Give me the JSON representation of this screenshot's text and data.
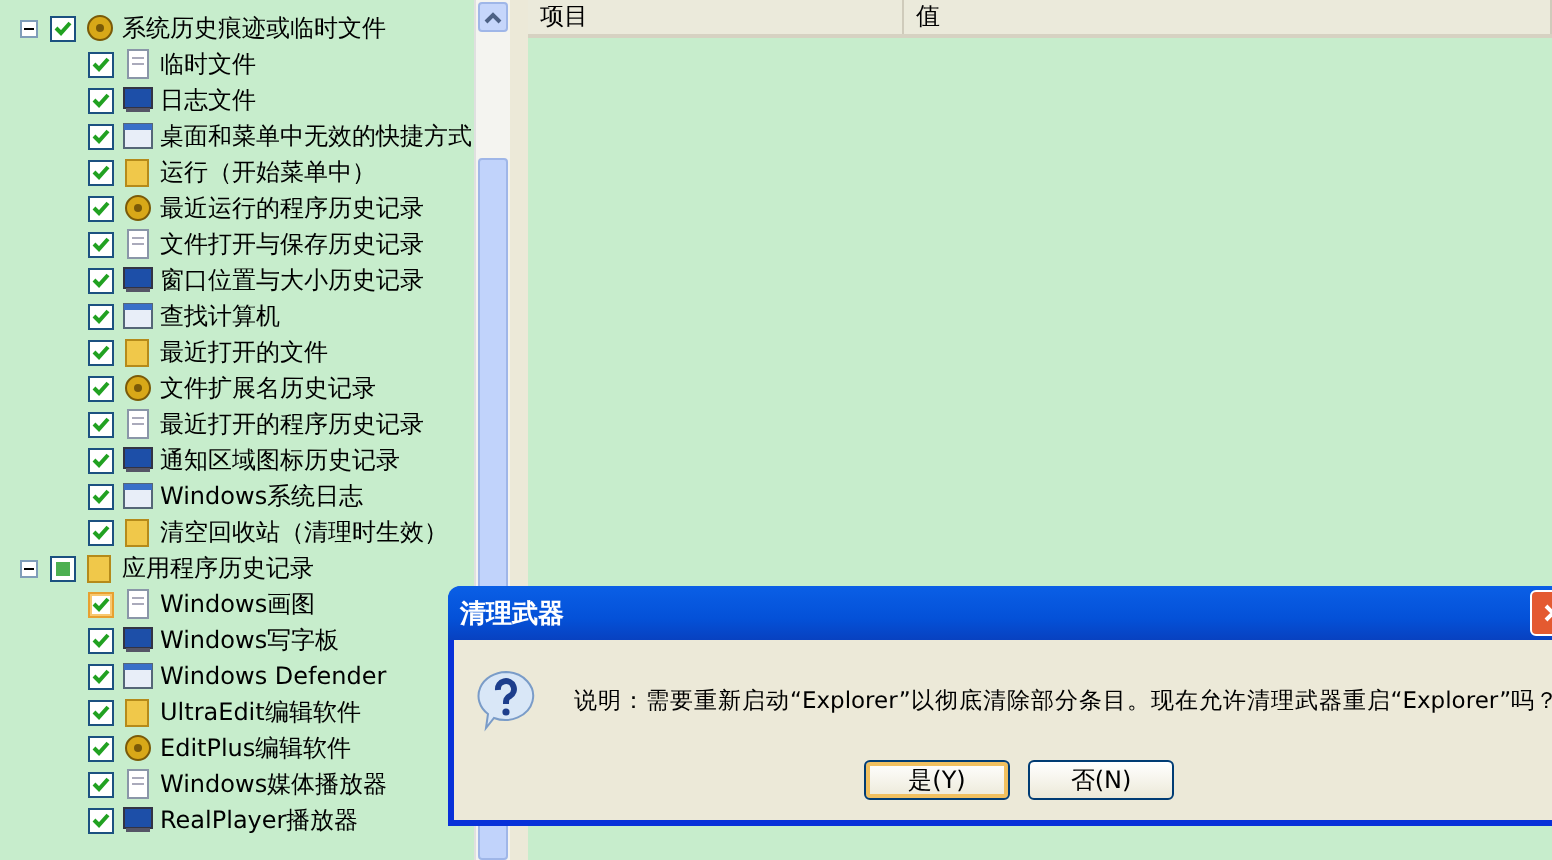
{
  "tree": [
    {
      "label": "系统历史痕迹或临时文件",
      "expanded": true,
      "checked": true,
      "partial": false,
      "children": [
        {
          "label": "临时文件",
          "checked": true,
          "hovered": false
        },
        {
          "label": "日志文件",
          "checked": true,
          "hovered": false
        },
        {
          "label": "桌面和菜单中无效的快捷方式",
          "checked": true,
          "hovered": false
        },
        {
          "label": "运行（开始菜单中）",
          "checked": true,
          "hovered": false
        },
        {
          "label": "最近运行的程序历史记录",
          "checked": true,
          "hovered": false
        },
        {
          "label": "文件打开与保存历史记录",
          "checked": true,
          "hovered": false
        },
        {
          "label": "窗口位置与大小历史记录",
          "checked": true,
          "hovered": false
        },
        {
          "label": "查找计算机",
          "checked": true,
          "hovered": false
        },
        {
          "label": "最近打开的文件",
          "checked": true,
          "hovered": false
        },
        {
          "label": "文件扩展名历史记录",
          "checked": true,
          "hovered": false
        },
        {
          "label": "最近打开的程序历史记录",
          "checked": true,
          "hovered": false
        },
        {
          "label": "通知区域图标历史记录",
          "checked": true,
          "hovered": false
        },
        {
          "label": "Windows系统日志",
          "checked": true,
          "hovered": false
        },
        {
          "label": "清空回收站（清理时生效）",
          "checked": true,
          "hovered": false
        }
      ]
    },
    {
      "label": "应用程序历史记录",
      "expanded": true,
      "checked": false,
      "partial": true,
      "children": [
        {
          "label": "Windows画图",
          "checked": true,
          "hovered": true
        },
        {
          "label": "Windows写字板",
          "checked": true,
          "hovered": false
        },
        {
          "label": "Windows Defender",
          "checked": true,
          "hovered": false
        },
        {
          "label": "UltraEdit编辑软件",
          "checked": true,
          "hovered": false
        },
        {
          "label": "EditPlus编辑软件",
          "checked": true,
          "hovered": false
        },
        {
          "label": "Windows媒体播放器",
          "checked": true,
          "hovered": false
        },
        {
          "label": "RealPlayer播放器",
          "checked": true,
          "hovered": false
        }
      ]
    }
  ],
  "list": {
    "columns": [
      "项目",
      "值"
    ]
  },
  "dialog": {
    "title": "清理武器",
    "message": "说明：需要重新启动“Explorer”以彻底清除部分条目。现在允许清理武器重启“Explorer”吗？",
    "buttons": [
      {
        "label": "是(Y)",
        "selected": true
      },
      {
        "label": "否(N)",
        "selected": false
      }
    ]
  }
}
